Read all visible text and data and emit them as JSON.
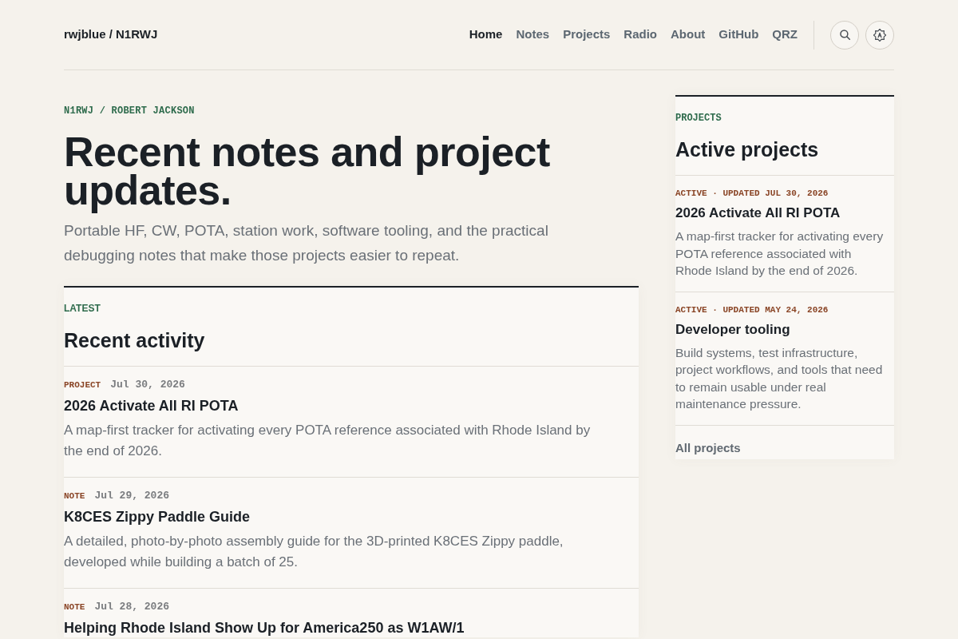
{
  "header": {
    "brand": "rwjblue / N1RWJ",
    "nav": [
      {
        "label": "Home",
        "selected": true
      },
      {
        "label": "Notes",
        "selected": false
      },
      {
        "label": "Projects",
        "selected": false
      },
      {
        "label": "Radio",
        "selected": false
      },
      {
        "label": "About",
        "selected": false
      },
      {
        "label": "GitHub",
        "selected": false
      },
      {
        "label": "QRZ",
        "selected": false
      }
    ],
    "buttons": [
      {
        "kind": "search"
      },
      {
        "kind": "theme"
      }
    ]
  },
  "hero": {
    "eyebrow": "N1RWJ / ROBERT JACKSON",
    "title": "Recent notes and project updates.",
    "intro": "Portable HF, CW, POTA, station work, software tooling, and the practical debugging notes that make those projects easier to repeat."
  },
  "activity": {
    "eyebrow": "LATEST",
    "heading": "Recent activity",
    "items": [
      {
        "tag": "PROJECT",
        "date": "Jul 30, 2026",
        "title": "2026 Activate All RI POTA",
        "summary": "A map-first tracker for activating every POTA reference associated with Rhode Island by the end of 2026."
      },
      {
        "tag": "NOTE",
        "date": "Jul 29, 2026",
        "title": "K8CES Zippy Paddle Guide",
        "summary": "A detailed, photo-by-photo assembly guide for the 3D-printed K8CES Zippy paddle, developed while building a batch of 25."
      },
      {
        "tag": "NOTE",
        "date": "Jul 28, 2026",
        "title": "Helping Rhode Island Show Up for America250 as W1AW/1"
      }
    ]
  },
  "projects": {
    "eyebrow": "PROJECTS",
    "heading": "Active projects",
    "items": [
      {
        "meta": "ACTIVE · UPDATED JUL 30, 2026",
        "title": "2026 Activate All RI POTA",
        "summary": "A map-first tracker for activating every POTA reference associated with Rhode Island by the end of 2026."
      },
      {
        "meta": "ACTIVE · UPDATED MAY 24, 2026",
        "title": "Developer tooling",
        "summary": "Build systems, test infrastructure, project workflows, and tools that need to remain usable under real maintenance pressure."
      }
    ],
    "link": "All projects"
  }
}
